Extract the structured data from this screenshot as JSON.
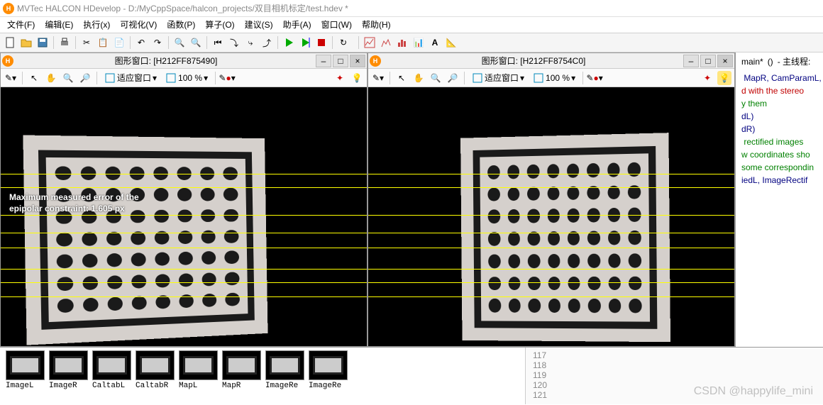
{
  "title": "MVTec HALCON HDevelop - D:/MyCppSpace/halcon_projects/双目相机标定/test.hdev *",
  "menu": [
    "文件(F)",
    "编辑(E)",
    "执行(x)",
    "可视化(V)",
    "函数(P)",
    "算子(O)",
    "建议(S)",
    "助手(A)",
    "窗口(W)",
    "帮助(H)"
  ],
  "gwin": {
    "left_title": "图形窗口: [H212FF875490]",
    "right_title": "图形窗口: [H212FF8754C0]",
    "fit_label": "适应窗口",
    "zoom_label": "100 %"
  },
  "left_overlay_1": "Maximum measured error of the",
  "left_overlay_2": "epipolar constraint: 1.605 px",
  "epi_lines": [
    222,
    241,
    280,
    305,
    326,
    356,
    375,
    395
  ],
  "code_head": {
    "proc": "main*",
    "args": "()",
    "thread": "- 主线程:"
  },
  "code_lines": [
    {
      "t": " MapR, CamParamL,",
      "c": "navy"
    },
    {
      "t": "d with the stereo",
      "c": "red"
    },
    {
      "t": "",
      "c": ""
    },
    {
      "t": "",
      "c": ""
    },
    {
      "t": "y them",
      "c": "green"
    },
    {
      "t": "dL)",
      "c": "navy"
    },
    {
      "t": "dR)",
      "c": "navy"
    },
    {
      "t": " rectified images",
      "c": "green"
    },
    {
      "t": "w coordinates sho",
      "c": "green"
    },
    {
      "t": "some correspondin",
      "c": "green"
    },
    {
      "t": "iedL, ImageRectif",
      "c": "navy"
    }
  ],
  "thumbs": [
    "ImageL",
    "ImageR",
    "CaltabL",
    "CaltabR",
    "MapL",
    "MapR",
    "ImageRe",
    "ImageRe"
  ],
  "line_nums": [
    "117",
    "118",
    "119",
    "120",
    "121"
  ],
  "watermark": "CSDN @happylife_mini"
}
